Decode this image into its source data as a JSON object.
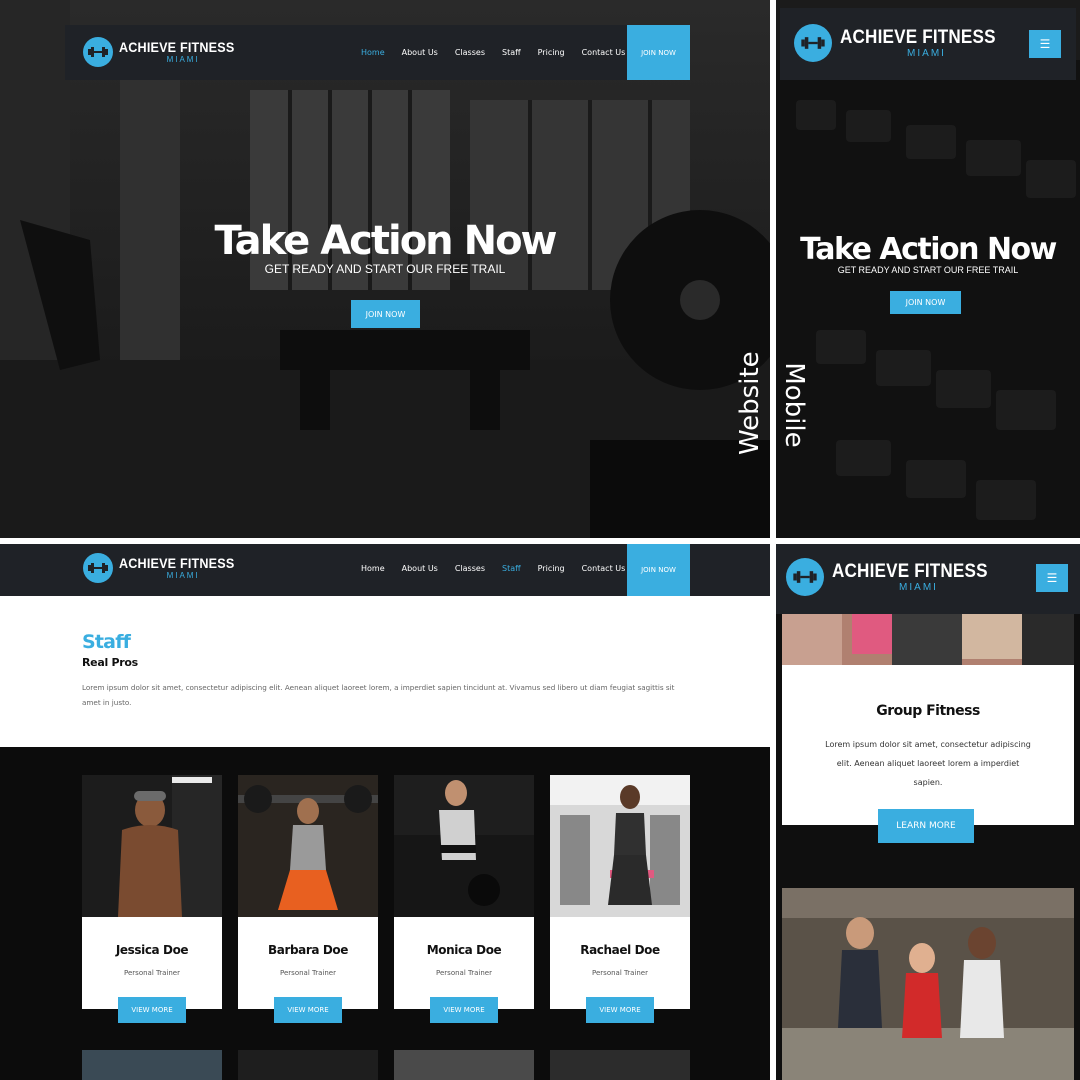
{
  "brand": {
    "name": "ACHIEVE FITNESS",
    "location": "MIAMI"
  },
  "nav": {
    "items": [
      "Home",
      "About Us",
      "Classes",
      "Staff",
      "Pricing",
      "Contact Us"
    ],
    "join_label": "JOIN NOW"
  },
  "hero": {
    "title": "Take Action Now",
    "subtitle": "GET READY AND START OUR FREE TRAIL",
    "button": "JOIN NOW"
  },
  "labels": {
    "website": "Website",
    "mobile": "Mobile"
  },
  "staff_section": {
    "title": "Staff",
    "subtitle": "Real Pros",
    "body": "Lorem ipsum dolor sit amet, consectetur adipiscing elit. Aenean aliquet laoreet lorem, a imperdiet sapien tincidunt at. Vivamus sed libero ut diam feugiat sagittis sit amet in justo.",
    "members": [
      {
        "name": "Jessica Doe",
        "role": "Personal Trainer",
        "button": "VIEW MORE"
      },
      {
        "name": "Barbara Doe",
        "role": "Personal Trainer",
        "button": "VIEW MORE"
      },
      {
        "name": "Monica Doe",
        "role": "Personal Trainer",
        "button": "VIEW MORE"
      },
      {
        "name": "Rachael Doe",
        "role": "Personal Trainer",
        "button": "VIEW MORE"
      }
    ]
  },
  "mobile_class": {
    "title": "Group Fitness",
    "body": "Lorem ipsum dolor sit amet, consectetur adipiscing elit. Aenean aliquet laoreet lorem a imperdiet sapien.",
    "button": "LEARN MORE"
  },
  "colors": {
    "accent": "#3aaee0",
    "nav_bg": "#1f2227",
    "dark_bg": "#0c0c0c"
  },
  "icons": {
    "logo": "dumbbell-icon",
    "menu": "hamburger-menu-icon"
  }
}
